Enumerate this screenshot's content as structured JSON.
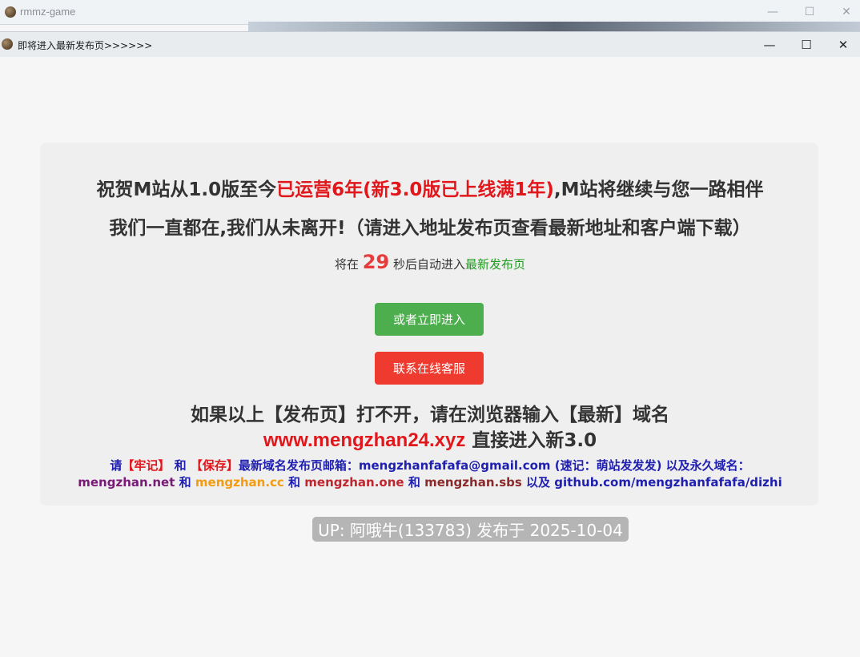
{
  "outer_window": {
    "title": "rmmz-game",
    "buttons": [
      "—",
      "☐",
      "✕"
    ]
  },
  "inner_window": {
    "title": "即将进入最新发布页>>>>>>",
    "buttons": [
      "—",
      "☐",
      "✕"
    ]
  },
  "card": {
    "line1_part1": "祝贺M站从1.0版至今",
    "line1_part2": "已运营6年(新3.0版已上线满1年)",
    "line1_part3": ",M站将继续与您一路相伴",
    "line2": "我们一直都在,我们从未离开!（请进入地址发布页查看最新地址和客户端下载）",
    "countdown_prefix": "将在",
    "countdown_number": "29",
    "countdown_suffix": "秒后自动进入",
    "countdown_link": "最新发布页",
    "enter_button": "或者立即进入",
    "support_button": "联系在线客服",
    "line3": "如果以上【发布页】打不开，请在浏览器输入【最新】域名",
    "domain": "www.mengzhan24.xyz",
    "line4_suffix": "直接进入新3.0",
    "mail_p1": "请",
    "mail_p2": "【牢记】",
    "mail_p3": "和",
    "mail_p4": "【保存】",
    "mail_p5": "最新域名发布页邮箱：mengzhanfafafa@gmail.com (速记：萌站发发发) 以及永久域名：",
    "dom1": "mengzhan.net",
    "and1": "和",
    "dom2": "mengzhan.cc",
    "and2": "和",
    "dom3": "mengzhan.one",
    "and3": "和",
    "dom4": "mengzhan.sbs",
    "and4": "以及",
    "dom5": "github.com/mengzhanfafafa/dizhi"
  },
  "footer_badge": "UP: 阿哦牛(133783) 发布于 2025-10-04",
  "colors": {
    "accent_red": "#e2171c",
    "enter_button": "#4cae4c",
    "support_button": "#ef3b2f",
    "link_blue": "#1f1fb0"
  }
}
